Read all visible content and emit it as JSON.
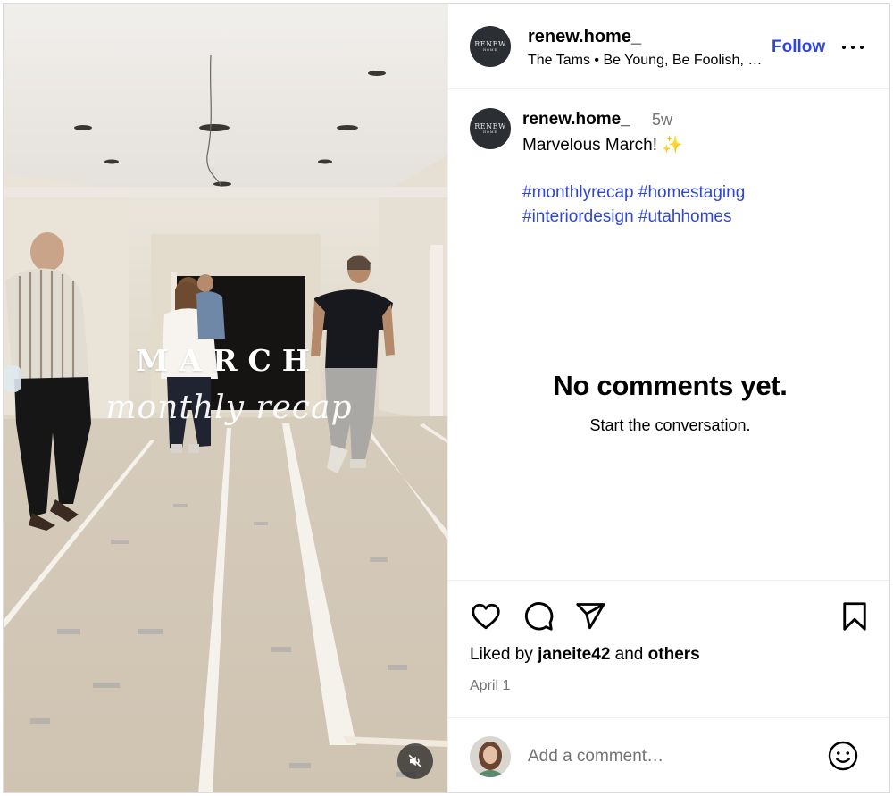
{
  "media": {
    "overlay_title": "MARCH",
    "overlay_subtitle": "monthly recap",
    "mute_icon": "speaker-muted-icon"
  },
  "header": {
    "avatar_text": "RENEW",
    "avatar_subtext": "HOME",
    "username": "renew.home_",
    "audio": "The Tams • Be Young, Be Foolish, Be Happy",
    "follow_label": "Follow",
    "more_icon": "more-options-icon"
  },
  "caption": {
    "username": "renew.home_",
    "time": "5w",
    "text": "Marvelous March!",
    "emoji": "✨",
    "hashtags": [
      "#monthlyrecap",
      "#homestaging",
      "#interiordesign",
      "#utahhomes"
    ]
  },
  "comments": {
    "empty_title": "No comments yet.",
    "empty_subtitle": "Start the conversation."
  },
  "actions": {
    "icons": [
      "heart-icon",
      "comment-icon",
      "share-icon",
      "bookmark-icon"
    ],
    "liked_prefix": "Liked by",
    "liked_user": "janeite42",
    "liked_and": "and",
    "liked_others": "others",
    "date": "April 1"
  },
  "comment_box": {
    "placeholder": "Add a comment…",
    "emoji_icon": "emoji-smile-icon"
  },
  "colors": {
    "link_blue": "#2f46d4",
    "muted_gray": "#737373",
    "border": "#efefef"
  }
}
